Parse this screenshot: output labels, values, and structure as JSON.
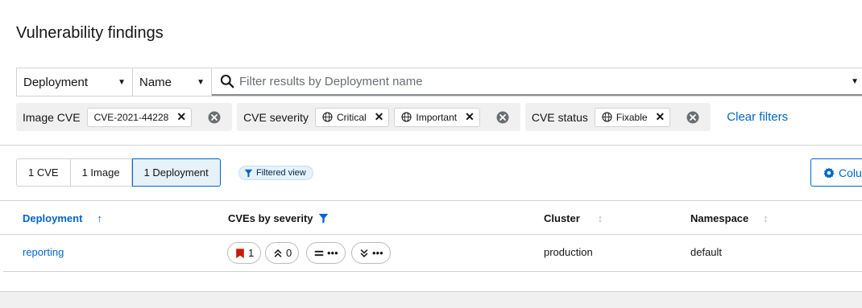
{
  "page": {
    "title": "Vulnerability findings"
  },
  "toolbar": {
    "entity_select": "Deployment",
    "attribute_select": "Name",
    "search_placeholder": "Filter results by Deployment name"
  },
  "filter_groups": [
    {
      "label": "Image CVE",
      "chips": [
        "CVE-2021-44228"
      ]
    },
    {
      "label": "CVE severity",
      "chips": [
        "Critical",
        "Important"
      ]
    },
    {
      "label": "CVE status",
      "chips": [
        "Fixable"
      ]
    }
  ],
  "clear_filters_label": "Clear filters",
  "entity_toggles": [
    {
      "label": "1 CVE",
      "active": false
    },
    {
      "label": "1 Image",
      "active": false
    },
    {
      "label": "1 Deployment",
      "active": true
    }
  ],
  "filtered_view_label": "Filtered view",
  "columns_button_label": "Colu",
  "table": {
    "headers": {
      "deployment": "Deployment",
      "cves_by_severity": "CVEs by severity",
      "cluster": "Cluster",
      "namespace": "Namespace"
    },
    "rows": [
      {
        "deployment": "reporting",
        "severity_counts": {
          "critical": "1",
          "important": "0",
          "moderate": "•••",
          "low": "•••"
        },
        "cluster": "production",
        "namespace": "default"
      }
    ]
  },
  "colors": {
    "link": "#0066cc",
    "critical": "#c9190b",
    "border": "#d2d2d2",
    "chip_group_bg": "#f0f0f0"
  }
}
